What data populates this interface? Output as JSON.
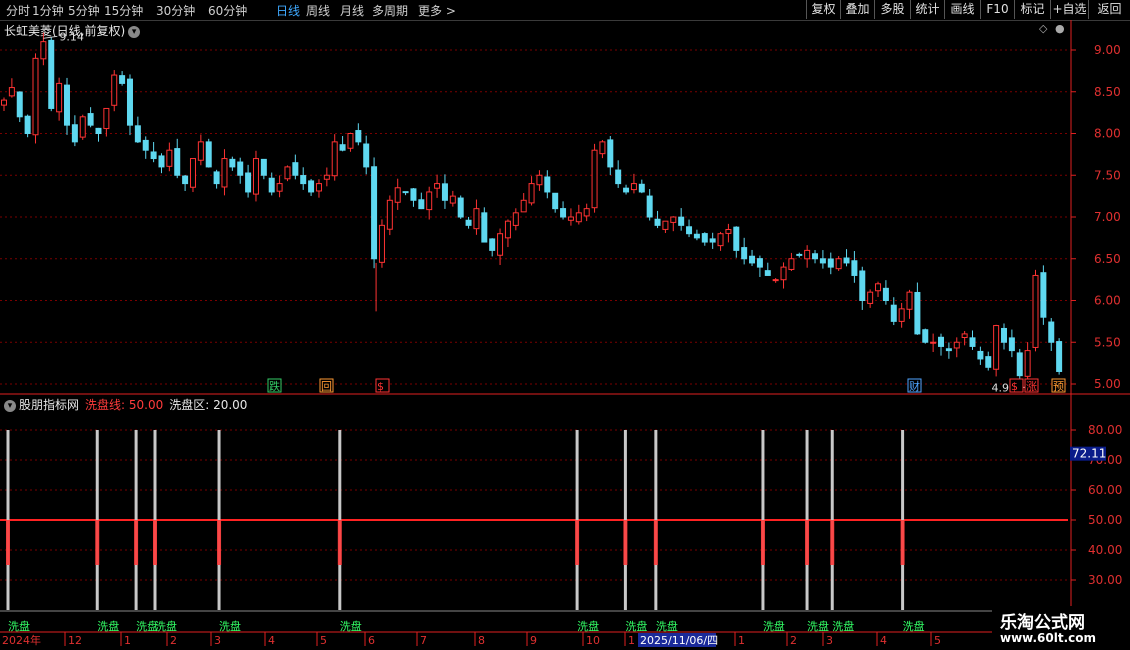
{
  "toolbar": {
    "periods": [
      "分时",
      "1分钟",
      "5分钟",
      "15分钟",
      "30分钟",
      "60分钟",
      "日线",
      "周线",
      "月线",
      "多周期",
      "更多 >"
    ],
    "active_period": "日线",
    "right_buttons": [
      "复权",
      "叠加",
      "多股",
      "统计",
      "画线",
      "F10",
      "标记",
      "+自选",
      "返回"
    ]
  },
  "main_panel": {
    "title": "长虹美菱(日线,前复权)",
    "high_label": "9.14",
    "low_label": "4.96",
    "markers": [
      {
        "text": "跌",
        "color": "#33cc66"
      },
      {
        "text": "回",
        "color": "#ff9a33"
      },
      {
        "text": "$",
        "color": "#ff3333"
      },
      {
        "text": "财",
        "color": "#4fa3ff"
      },
      {
        "text": "$",
        "color": "#ff3333"
      },
      {
        "text": "涨",
        "color": "#ff3333"
      },
      {
        "text": "预",
        "color": "#ff9a33"
      }
    ]
  },
  "sub_panel": {
    "name": "股朋指标网",
    "line_label": "洗盘线: 50.00",
    "zone_label": "洗盘区: 20.00",
    "current_value": "72.11",
    "signal_label": "洗盘"
  },
  "date_axis": {
    "labels": [
      "2024年",
      "12",
      "1",
      "2",
      "3",
      "4",
      "5",
      "6",
      "7",
      "8",
      "9",
      "10",
      "1",
      "2025/11/06/四",
      "1",
      "2",
      "3",
      "4",
      "5"
    ]
  },
  "watermark": {
    "line1": "乐淘公式网",
    "line2": "www.60lt.com"
  },
  "colors": {
    "up": "#ff3333",
    "down": "#5fd8f0",
    "grid": "#7a0000",
    "axis": "#e02020",
    "signal": "#c8c8c8",
    "signal_text": "#33ff66"
  },
  "chart_data": [
    {
      "type": "candlestick",
      "title": "长虹美菱(日线,前复权)",
      "ylim": [
        4.8,
        9.45
      ],
      "yticks": [
        5.0,
        5.5,
        6.0,
        6.5,
        7.0,
        7.5,
        8.0,
        8.5,
        9.0
      ],
      "ytick_labels": [
        "5.00",
        "5.50",
        "6.00",
        "6.50",
        "7.00",
        "7.50",
        "8.00",
        "8.50",
        "9.00"
      ],
      "close_path": [
        8.4,
        8.55,
        8.2,
        8.0,
        8.9,
        9.1,
        8.3,
        8.6,
        8.1,
        7.9,
        8.2,
        8.1,
        8.0,
        8.3,
        8.7,
        8.6,
        8.1,
        7.9,
        7.8,
        7.7,
        7.6,
        7.8,
        7.5,
        7.4,
        7.7,
        7.9,
        7.6,
        7.4,
        7.7,
        7.6,
        7.5,
        7.3,
        7.7,
        7.5,
        7.3,
        7.4,
        7.6,
        7.5,
        7.4,
        7.3,
        7.4,
        7.5,
        7.9,
        7.8,
        8.0,
        7.9,
        7.6,
        6.5,
        6.9,
        7.2,
        7.35,
        7.3,
        7.2,
        7.1,
        7.3,
        7.4,
        7.2,
        7.25,
        7.0,
        6.9,
        7.1,
        6.7,
        6.6,
        6.8,
        6.95,
        7.05,
        7.2,
        7.4,
        7.5,
        7.3,
        7.1,
        7.0,
        7.0,
        7.05,
        7.1,
        7.8,
        7.9,
        7.6,
        7.4,
        7.3,
        7.4,
        7.3,
        7.0,
        6.9,
        6.95,
        7.0,
        6.9,
        6.8,
        6.75,
        6.7,
        6.7,
        6.8,
        6.85,
        6.6,
        6.5,
        6.45,
        6.4,
        6.3,
        6.25,
        6.4,
        6.5,
        6.55,
        6.6,
        6.5,
        6.45,
        6.4,
        6.5,
        6.45,
        6.3,
        6.0,
        6.1,
        6.2,
        6.0,
        5.75,
        5.9,
        6.1,
        5.6,
        5.5,
        5.5,
        5.45,
        5.4,
        5.5,
        5.6,
        5.45,
        5.3,
        5.2,
        5.7,
        5.5,
        5.4,
        5.1,
        5.4,
        6.3,
        5.8,
        5.5,
        5.15
      ],
      "high": 9.14,
      "low": 4.96
    },
    {
      "type": "line",
      "title": "股朋指标网",
      "ylim": [
        20,
        90
      ],
      "yticks": [
        30,
        40,
        50,
        60,
        70,
        80
      ],
      "ytick_labels": [
        "30.00",
        "40.00",
        "50.00",
        "60.00",
        "70.00",
        "80.00"
      ],
      "series": [
        {
          "name": "洗盘线",
          "values": [
            50.0
          ]
        },
        {
          "name": "洗盘区",
          "values": [
            20.0
          ]
        }
      ],
      "current": 72.11,
      "signal_positions": [
        0.0,
        0.085,
        0.122,
        0.14,
        0.201,
        0.316,
        0.542,
        0.588,
        0.617,
        0.719,
        0.761,
        0.785,
        0.852
      ]
    }
  ]
}
